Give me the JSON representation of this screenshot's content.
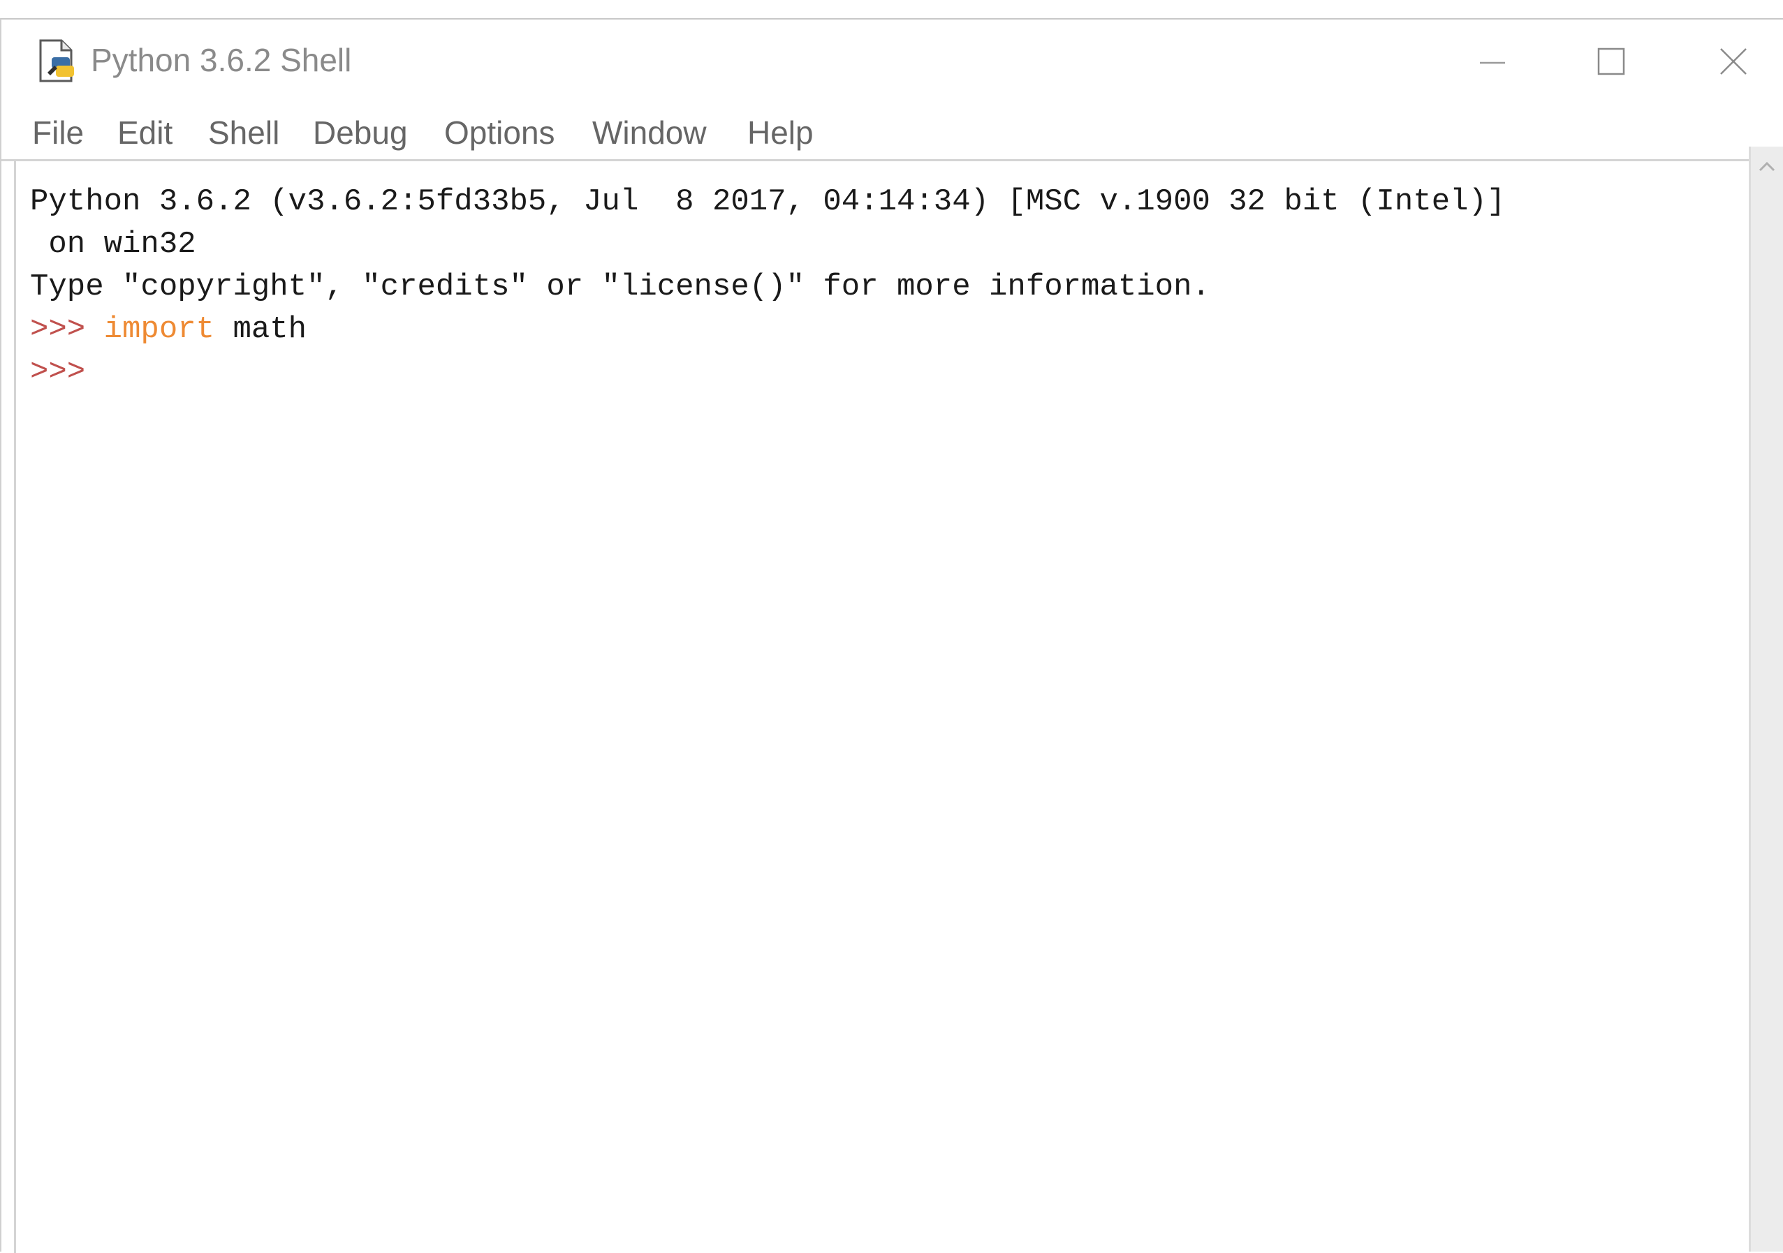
{
  "window": {
    "title": "Python 3.6.2 Shell"
  },
  "menubar": {
    "items": [
      "File",
      "Edit",
      "Shell",
      "Debug",
      "Options",
      "Window",
      "Help"
    ]
  },
  "shell": {
    "line1": "Python 3.6.2 (v3.6.2:5fd33b5, Jul  8 2017, 04:14:34) [MSC v.1900 32 bit (Intel)]",
    "line2": " on win32",
    "line3": "Type \"copyright\", \"credits\" or \"license()\" for more information.",
    "prompt": ">>>",
    "keyword": "import",
    "module": "math"
  },
  "colors": {
    "prompt": "#c0504d",
    "keyword": "#ee8a33",
    "text": "#1a1a1a"
  },
  "icons": {
    "app": "idle-python-icon",
    "minimize": "minimize-icon",
    "maximize": "maximize-icon",
    "close": "close-icon",
    "scroll_up": "chevron-up-icon"
  }
}
